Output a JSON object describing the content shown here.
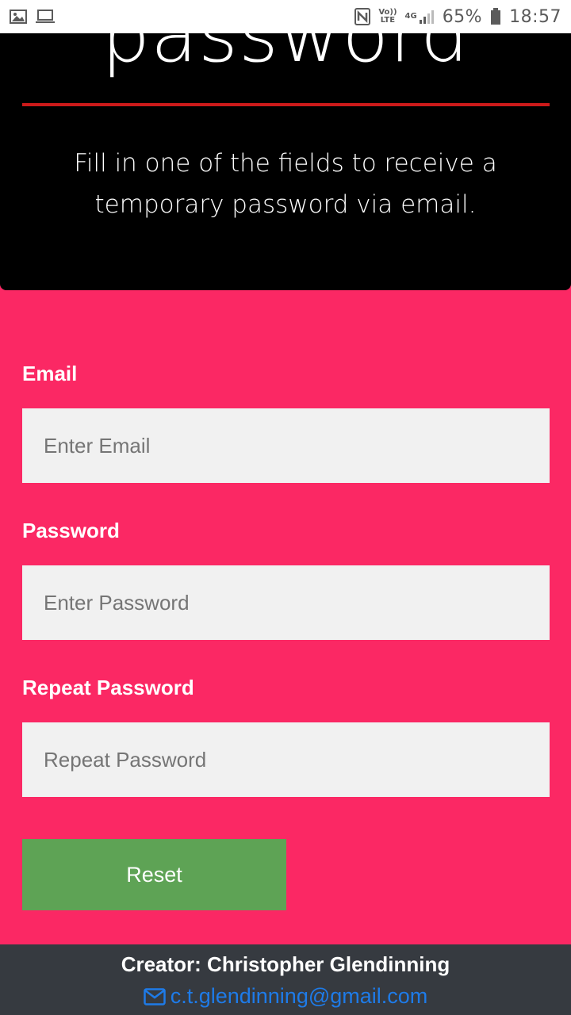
{
  "status_bar": {
    "battery_percent": "65%",
    "time": "18:57",
    "volte_top": "Vo))",
    "volte_bottom": "LTE",
    "network": "4G",
    "icons": [
      "image-icon",
      "laptop-icon",
      "nfc-icon",
      "volte-icon",
      "signal-icon",
      "battery-icon"
    ]
  },
  "header": {
    "title": "password",
    "subtitle": "Fill in one of the fields to receive a temporary password via email."
  },
  "form": {
    "email_label": "Email",
    "email_placeholder": "Enter Email",
    "password_label": "Password",
    "password_placeholder": "Enter Password",
    "repeat_label": "Repeat Password",
    "repeat_placeholder": "Repeat Password",
    "reset_label": "Reset"
  },
  "footer": {
    "creator": "Creator: Christopher Glendinning",
    "email": "c.t.glendinning@gmail.com",
    "email_icon": "envelope-icon"
  },
  "colors": {
    "page_background": "#fb2864",
    "header_background": "#000000",
    "underline": "#cc1a1a",
    "button": "#5ea355",
    "footer_background": "#363a40",
    "link": "#1e7be8"
  }
}
